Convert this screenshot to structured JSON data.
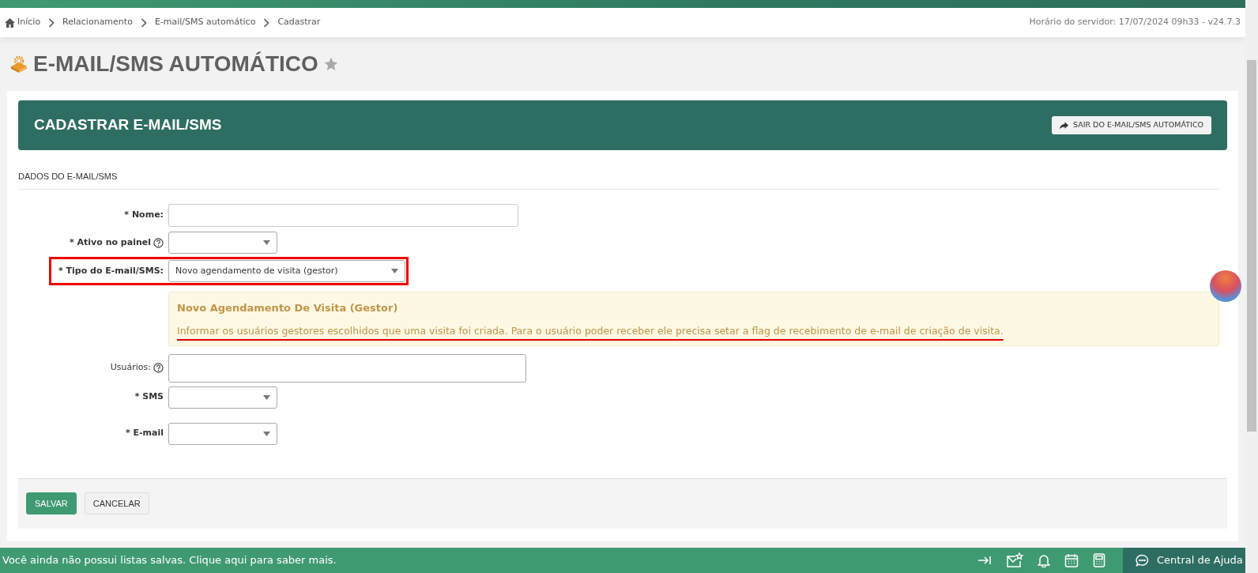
{
  "breadcrumb": [
    "Início",
    "Relacionamento",
    "E-mail/SMS automático",
    "Cadastrar"
  ],
  "server_time": "Horário do servidor: 17/07/2024 09h33 - v24.7.3",
  "page_title": "E-MAIL/SMS AUTOMÁTICO",
  "favorite": false,
  "panel": {
    "title": "CADASTRAR E-MAIL/SMS",
    "exit_button": "SAIR DO E-MAIL/SMS AUTOMÁTICO"
  },
  "section": "DADOS DO E-MAIL/SMS",
  "fields": [
    {
      "kind": "text",
      "label": "* Nome:",
      "required": true,
      "help": false,
      "highlighted": false
    },
    {
      "kind": "select",
      "label": "* Ativo no painel",
      "required": true,
      "help": true,
      "highlighted": false
    },
    {
      "kind": "select-wide",
      "label": "* Tipo do E-mail/SMS:",
      "required": true,
      "help": false,
      "value": "Novo agendamento de visita (gestor)",
      "highlighted": true
    },
    {
      "kind": "alert",
      "title": "Novo Agendamento De Visita (Gestor)",
      "text": "Informar os usuários gestores escolhidos que uma visita foi criada. Para o usuário poder receber ele precisa setar a flag de recebimento de e-mail de criação de visita.",
      "underlined": true
    },
    {
      "kind": "textarea",
      "label": "Usuários:",
      "required": false,
      "help": true,
      "highlighted": false
    },
    {
      "kind": "select",
      "label": "* SMS",
      "required": true,
      "help": false,
      "highlighted": false
    },
    {
      "kind": "select",
      "label": "* E-mail",
      "required": true,
      "help": false,
      "highlighted": false
    }
  ],
  "buttons": [
    {
      "label": "SALVAR",
      "kind": "primary"
    },
    {
      "label": "CANCELAR",
      "kind": "secondary"
    }
  ],
  "bottom_bar": {
    "message": "Você ainda não possui listas salvas. Clique aqui para saber mais.",
    "help_label": "Central de Ajuda"
  }
}
